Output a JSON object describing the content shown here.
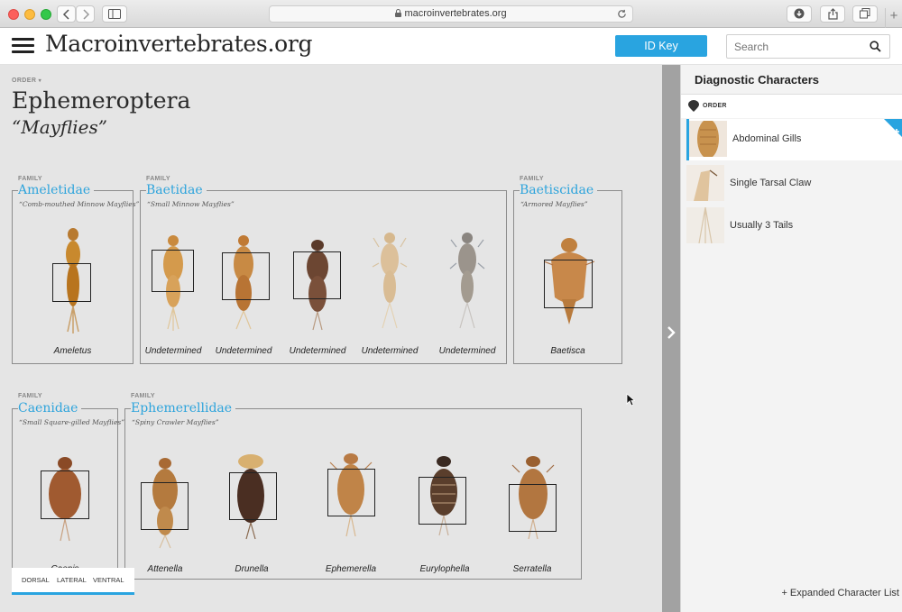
{
  "browser": {
    "url": "macroinvertebrates.org"
  },
  "header": {
    "site_title": "Macroinvertebrates.org",
    "id_key_label": "ID Key",
    "search_placeholder": "Search"
  },
  "main": {
    "order_label": "ORDER",
    "order_name": "Ephemeroptera",
    "order_common": "“Mayflies”",
    "family_label": "FAMILY",
    "families": [
      {
        "name": "Ameletidae",
        "common": "“Comb-mouthed Minnow Mayflies”",
        "genera": [
          "Ameletus"
        ]
      },
      {
        "name": "Baetidae",
        "common": "“Small Minnow Mayflies”",
        "genera": [
          "Undetermined",
          "Undetermined",
          "Undetermined",
          "Undetermined",
          "Undetermined"
        ]
      },
      {
        "name": "Baetiscidae",
        "common": "“Armored Mayflies”",
        "genera": [
          "Baetisca"
        ]
      },
      {
        "name": "Caenidae",
        "common": "“Small Square-gilled Mayflies”",
        "genera": [
          "Caenis"
        ]
      },
      {
        "name": "Ephemerellidae",
        "common": "“Spiny Crawler Mayflies”",
        "genera": [
          "Attenella",
          "Drunella",
          "Ephemerella",
          "Eurylophella",
          "Serratella"
        ]
      }
    ],
    "view_tabs": [
      "DORSAL",
      "LATERAL",
      "VENTRAL"
    ],
    "active_view_tab": "DORSAL"
  },
  "panel": {
    "title": "Diagnostic Characters",
    "level_label": "ORDER",
    "characters": [
      {
        "label": "Abdominal Gills",
        "selected": true
      },
      {
        "label": "Single Tarsal Claw",
        "selected": false
      },
      {
        "label": "Usually 3 Tails",
        "selected": false
      }
    ],
    "expanded_list_label": "+ Expanded Character List"
  },
  "colors": {
    "accent": "#29a4e0",
    "family_name": "#2ea4dc"
  },
  "icons": [
    "hamburger-menu-icon",
    "search-icon",
    "chevron-right-icon",
    "plus-icon",
    "order-marker-icon",
    "reload-icon",
    "download-icon",
    "share-icon",
    "tabs-icon",
    "sidebar-icon",
    "lock-icon"
  ]
}
